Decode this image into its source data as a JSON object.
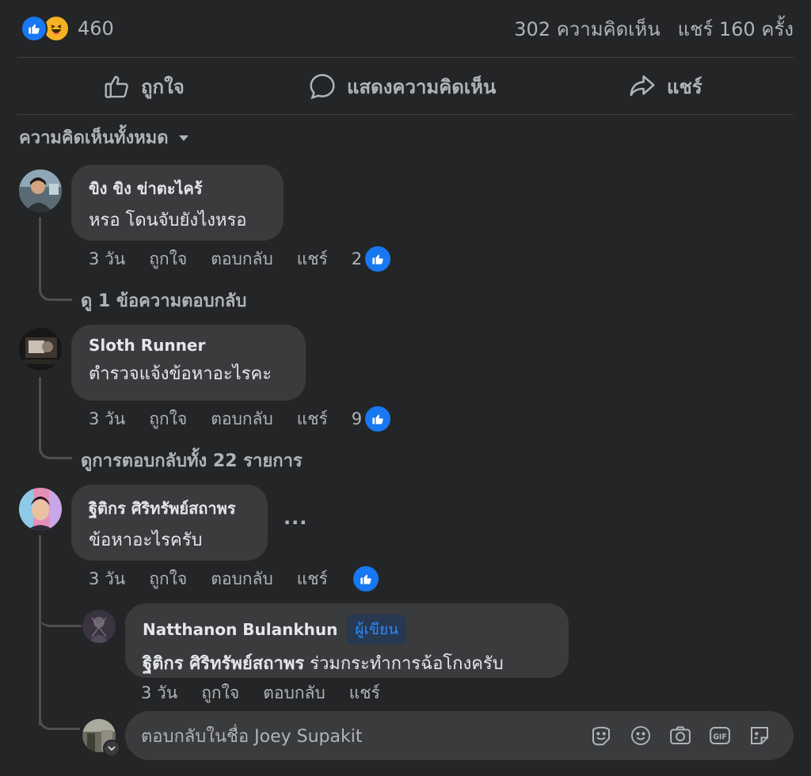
{
  "post": {
    "reaction_count": "460",
    "comments_count": "302 ความคิดเห็น",
    "shares_count": "แชร์ 160 ครั้ง"
  },
  "actions": {
    "like": "ถูกใจ",
    "comment": "แสดงความคิดเห็น",
    "share": "แชร์"
  },
  "sort_label": "ความคิดเห็นทั้งหมด",
  "comments": [
    {
      "name": "ขิง ขิง ข่าตะไคร้",
      "text": "หรอ โดนจับยังไงหรอ",
      "time": "3 วัน",
      "like": "ถูกใจ",
      "reply": "ตอบกลับ",
      "share": "แชร์",
      "likes": "2",
      "view_replies": "ดู 1 ข้อความตอบกลับ"
    },
    {
      "name": "Sloth Runner",
      "text": "ตำรวจแจ้งข้อหาอะไรคะ",
      "time": "3 วัน",
      "like": "ถูกใจ",
      "reply": "ตอบกลับ",
      "share": "แชร์",
      "likes": "9",
      "view_replies": "ดูการตอบกลับทั้ง 22 รายการ"
    },
    {
      "name": "ฐิติกร ศิริทรัพย์สถาพร",
      "text": "ข้อหาอะไรครับ",
      "time": "3 วัน",
      "like": "ถูกใจ",
      "reply": "ตอบกลับ",
      "share": "แชร์",
      "more": "···"
    }
  ],
  "reply": {
    "name": "Natthanon Bulankhun",
    "author_tag": "ผู้เขียน",
    "mention": "ฐิติกร ศิริทรัพย์สถาพร",
    "text": "ร่วมกระทำการฉ้อโกงครับ",
    "time": "3 วัน",
    "like": "ถูกใจ",
    "reply": "ตอบกลับ",
    "share": "แชร์"
  },
  "reply_box": {
    "placeholder": "ตอบกลับในชื่อ Joey Supakit"
  },
  "colors": {
    "background": "#242526",
    "bubble": "#3a3b3c",
    "accent": "#1877f2",
    "text": "#e4e6eb",
    "muted": "#b0b3b8"
  },
  "icons": [
    "like-reaction-icon",
    "haha-reaction-icon",
    "thumbs-up-icon",
    "comment-icon",
    "share-arrow-icon",
    "caret-down-icon",
    "sticker-icon",
    "emoji-icon",
    "camera-icon",
    "gif-icon",
    "avatar-sticker-icon"
  ]
}
